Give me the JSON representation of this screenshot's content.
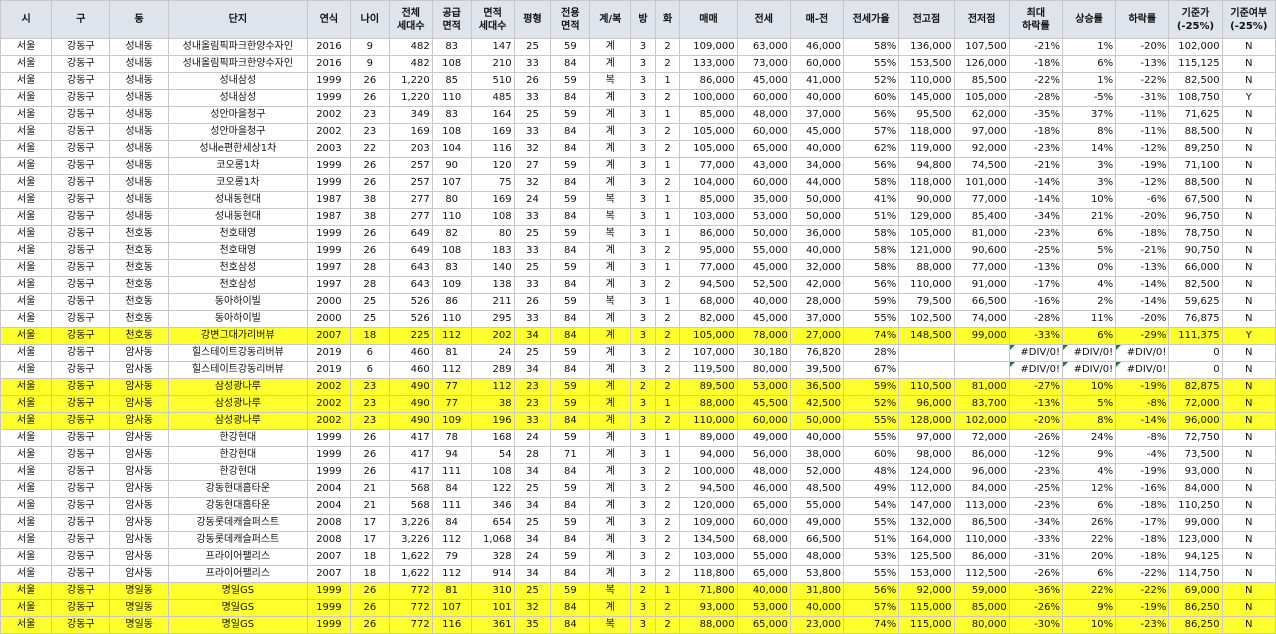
{
  "headers": [
    "시",
    "구",
    "동",
    "단지",
    "연식",
    "나이",
    "전체\n세대수",
    "공급\n면적",
    "면적\n세대수",
    "평형",
    "전용\n면적",
    "계/복",
    "방",
    "화",
    "매매",
    "전세",
    "매-전",
    "전세가율",
    "전고점",
    "전저점",
    "최대\n하락률",
    "상승률",
    "하락률",
    "기준가\n(-25%)",
    "기준여부\n(-25%)"
  ],
  "rows": [
    {
      "hl": false,
      "cells": [
        "서울",
        "강동구",
        "성내동",
        "성내올림픽파크한양수자인",
        "2016",
        "9",
        "482",
        "83",
        "147",
        "25",
        "59",
        "계",
        "3",
        "2",
        "109,000",
        "63,000",
        "46,000",
        "58%",
        "136,000",
        "107,500",
        "-21%",
        "1%",
        "-20%",
        "102,000",
        "N"
      ]
    },
    {
      "hl": false,
      "cells": [
        "서울",
        "강동구",
        "성내동",
        "성내올림픽파크한양수자인",
        "2016",
        "9",
        "482",
        "108",
        "210",
        "33",
        "84",
        "계",
        "3",
        "2",
        "133,000",
        "73,000",
        "60,000",
        "55%",
        "153,500",
        "126,000",
        "-18%",
        "6%",
        "-13%",
        "115,125",
        "N"
      ]
    },
    {
      "hl": false,
      "cells": [
        "서울",
        "강동구",
        "성내동",
        "성내삼성",
        "1999",
        "26",
        "1,220",
        "85",
        "510",
        "26",
        "59",
        "복",
        "3",
        "1",
        "86,000",
        "45,000",
        "41,000",
        "52%",
        "110,000",
        "85,500",
        "-22%",
        "1%",
        "-22%",
        "82,500",
        "N"
      ]
    },
    {
      "hl": false,
      "cells": [
        "서울",
        "강동구",
        "성내동",
        "성내삼성",
        "1999",
        "26",
        "1,220",
        "110",
        "485",
        "33",
        "84",
        "계",
        "3",
        "2",
        "100,000",
        "60,000",
        "40,000",
        "60%",
        "145,000",
        "105,000",
        "-28%",
        "-5%",
        "-31%",
        "108,750",
        "Y"
      ]
    },
    {
      "hl": false,
      "cells": [
        "서울",
        "강동구",
        "성내동",
        "성안마을청구",
        "2002",
        "23",
        "349",
        "83",
        "164",
        "25",
        "59",
        "계",
        "3",
        "1",
        "85,000",
        "48,000",
        "37,000",
        "56%",
        "95,500",
        "62,000",
        "-35%",
        "37%",
        "-11%",
        "71,625",
        "N"
      ]
    },
    {
      "hl": false,
      "cells": [
        "서울",
        "강동구",
        "성내동",
        "성안마을청구",
        "2002",
        "23",
        "169",
        "108",
        "169",
        "33",
        "84",
        "계",
        "3",
        "2",
        "105,000",
        "60,000",
        "45,000",
        "57%",
        "118,000",
        "97,000",
        "-18%",
        "8%",
        "-11%",
        "88,500",
        "N"
      ]
    },
    {
      "hl": false,
      "cells": [
        "서울",
        "강동구",
        "성내동",
        "성내e편한세상1차",
        "2003",
        "22",
        "203",
        "104",
        "116",
        "32",
        "84",
        "계",
        "3",
        "2",
        "105,000",
        "65,000",
        "40,000",
        "62%",
        "119,000",
        "92,000",
        "-23%",
        "14%",
        "-12%",
        "89,250",
        "N"
      ]
    },
    {
      "hl": false,
      "cells": [
        "서울",
        "강동구",
        "성내동",
        "코오롱1차",
        "1999",
        "26",
        "257",
        "90",
        "120",
        "27",
        "59",
        "계",
        "3",
        "1",
        "77,000",
        "43,000",
        "34,000",
        "56%",
        "94,800",
        "74,500",
        "-21%",
        "3%",
        "-19%",
        "71,100",
        "N"
      ]
    },
    {
      "hl": false,
      "cells": [
        "서울",
        "강동구",
        "성내동",
        "코오롱1차",
        "1999",
        "26",
        "257",
        "107",
        "75",
        "32",
        "84",
        "계",
        "3",
        "2",
        "104,000",
        "60,000",
        "44,000",
        "58%",
        "118,000",
        "101,000",
        "-14%",
        "3%",
        "-12%",
        "88,500",
        "N"
      ]
    },
    {
      "hl": false,
      "cells": [
        "서울",
        "강동구",
        "성내동",
        "성내동현대",
        "1987",
        "38",
        "277",
        "80",
        "169",
        "24",
        "59",
        "복",
        "3",
        "1",
        "85,000",
        "35,000",
        "50,000",
        "41%",
        "90,000",
        "77,000",
        "-14%",
        "10%",
        "-6%",
        "67,500",
        "N"
      ]
    },
    {
      "hl": false,
      "cells": [
        "서울",
        "강동구",
        "성내동",
        "성내동현대",
        "1987",
        "38",
        "277",
        "110",
        "108",
        "33",
        "84",
        "복",
        "3",
        "1",
        "103,000",
        "53,000",
        "50,000",
        "51%",
        "129,000",
        "85,400",
        "-34%",
        "21%",
        "-20%",
        "96,750",
        "N"
      ]
    },
    {
      "hl": false,
      "cells": [
        "서울",
        "강동구",
        "천호동",
        "천호태영",
        "1999",
        "26",
        "649",
        "82",
        "80",
        "25",
        "59",
        "복",
        "3",
        "1",
        "86,000",
        "50,000",
        "36,000",
        "58%",
        "105,000",
        "81,000",
        "-23%",
        "6%",
        "-18%",
        "78,750",
        "N"
      ]
    },
    {
      "hl": false,
      "cells": [
        "서울",
        "강동구",
        "천호동",
        "천호태영",
        "1999",
        "26",
        "649",
        "108",
        "183",
        "33",
        "84",
        "계",
        "3",
        "2",
        "95,000",
        "55,000",
        "40,000",
        "58%",
        "121,000",
        "90,600",
        "-25%",
        "5%",
        "-21%",
        "90,750",
        "N"
      ]
    },
    {
      "hl": false,
      "cells": [
        "서울",
        "강동구",
        "천호동",
        "천호삼성",
        "1997",
        "28",
        "643",
        "83",
        "140",
        "25",
        "59",
        "계",
        "3",
        "1",
        "77,000",
        "45,000",
        "32,000",
        "58%",
        "88,000",
        "77,000",
        "-13%",
        "0%",
        "-13%",
        "66,000",
        "N"
      ]
    },
    {
      "hl": false,
      "cells": [
        "서울",
        "강동구",
        "천호동",
        "천호삼성",
        "1997",
        "28",
        "643",
        "109",
        "138",
        "33",
        "84",
        "계",
        "3",
        "2",
        "94,500",
        "52,500",
        "42,000",
        "56%",
        "110,000",
        "91,000",
        "-17%",
        "4%",
        "-14%",
        "82,500",
        "N"
      ]
    },
    {
      "hl": false,
      "cells": [
        "서울",
        "강동구",
        "천호동",
        "동아하이빌",
        "2000",
        "25",
        "526",
        "86",
        "211",
        "26",
        "59",
        "복",
        "3",
        "1",
        "68,000",
        "40,000",
        "28,000",
        "59%",
        "79,500",
        "66,500",
        "-16%",
        "2%",
        "-14%",
        "59,625",
        "N"
      ]
    },
    {
      "hl": false,
      "cells": [
        "서울",
        "강동구",
        "천호동",
        "동아하이빌",
        "2000",
        "25",
        "526",
        "110",
        "295",
        "33",
        "84",
        "계",
        "3",
        "2",
        "82,000",
        "45,000",
        "37,000",
        "55%",
        "102,500",
        "74,000",
        "-28%",
        "11%",
        "-20%",
        "76,875",
        "N"
      ]
    },
    {
      "hl": true,
      "cells": [
        "서울",
        "강동구",
        "천호동",
        "강변그대가리버뷰",
        "2007",
        "18",
        "225",
        "112",
        "202",
        "34",
        "84",
        "계",
        "3",
        "2",
        "105,000",
        "78,000",
        "27,000",
        "74%",
        "148,500",
        "99,000",
        "-33%",
        "6%",
        "-29%",
        "111,375",
        "Y"
      ]
    },
    {
      "hl": false,
      "cells": [
        "서울",
        "강동구",
        "암사동",
        "힐스테이트강동리버뷰",
        "2019",
        "6",
        "460",
        "81",
        "24",
        "25",
        "59",
        "계",
        "3",
        "2",
        "107,000",
        "30,180",
        "76,820",
        "28%",
        "",
        "",
        "#DIV/0!",
        "#DIV/0!",
        "#DIV/0!",
        "0",
        "N"
      ]
    },
    {
      "hl": false,
      "cells": [
        "서울",
        "강동구",
        "암사동",
        "힐스테이트강동리버뷰",
        "2019",
        "6",
        "460",
        "112",
        "289",
        "34",
        "84",
        "계",
        "3",
        "2",
        "119,500",
        "80,000",
        "39,500",
        "67%",
        "",
        "",
        "#DIV/0!",
        "#DIV/0!",
        "#DIV/0!",
        "0",
        "N"
      ]
    },
    {
      "hl": true,
      "cells": [
        "서울",
        "강동구",
        "암사동",
        "삼성광나루",
        "2002",
        "23",
        "490",
        "77",
        "112",
        "23",
        "59",
        "계",
        "2",
        "2",
        "89,500",
        "53,000",
        "36,500",
        "59%",
        "110,500",
        "81,000",
        "-27%",
        "10%",
        "-19%",
        "82,875",
        "N"
      ]
    },
    {
      "hl": true,
      "cells": [
        "서울",
        "강동구",
        "암사동",
        "삼성광나루",
        "2002",
        "23",
        "490",
        "77",
        "38",
        "23",
        "59",
        "계",
        "3",
        "1",
        "88,000",
        "45,500",
        "42,500",
        "52%",
        "96,000",
        "83,700",
        "-13%",
        "5%",
        "-8%",
        "72,000",
        "N"
      ]
    },
    {
      "hl": true,
      "cells": [
        "서울",
        "강동구",
        "암사동",
        "삼성광나루",
        "2002",
        "23",
        "490",
        "109",
        "196",
        "33",
        "84",
        "계",
        "3",
        "2",
        "110,000",
        "60,000",
        "50,000",
        "55%",
        "128,000",
        "102,000",
        "-20%",
        "8%",
        "-14%",
        "96,000",
        "N"
      ]
    },
    {
      "hl": false,
      "cells": [
        "서울",
        "강동구",
        "암사동",
        "한강현대",
        "1999",
        "26",
        "417",
        "78",
        "168",
        "24",
        "59",
        "계",
        "3",
        "1",
        "89,000",
        "49,000",
        "40,000",
        "55%",
        "97,000",
        "72,000",
        "-26%",
        "24%",
        "-8%",
        "72,750",
        "N"
      ]
    },
    {
      "hl": false,
      "cells": [
        "서울",
        "강동구",
        "암사동",
        "한강현대",
        "1999",
        "26",
        "417",
        "94",
        "54",
        "28",
        "71",
        "계",
        "3",
        "1",
        "94,000",
        "56,000",
        "38,000",
        "60%",
        "98,000",
        "86,000",
        "-12%",
        "9%",
        "-4%",
        "73,500",
        "N"
      ]
    },
    {
      "hl": false,
      "cells": [
        "서울",
        "강동구",
        "암사동",
        "한강현대",
        "1999",
        "26",
        "417",
        "111",
        "108",
        "34",
        "84",
        "계",
        "3",
        "2",
        "100,000",
        "48,000",
        "52,000",
        "48%",
        "124,000",
        "96,000",
        "-23%",
        "4%",
        "-19%",
        "93,000",
        "N"
      ]
    },
    {
      "hl": false,
      "cells": [
        "서울",
        "강동구",
        "암사동",
        "강동현대홈타운",
        "2004",
        "21",
        "568",
        "84",
        "122",
        "25",
        "59",
        "계",
        "3",
        "2",
        "94,500",
        "46,000",
        "48,500",
        "49%",
        "112,000",
        "84,000",
        "-25%",
        "12%",
        "-16%",
        "84,000",
        "N"
      ]
    },
    {
      "hl": false,
      "cells": [
        "서울",
        "강동구",
        "암사동",
        "강동현대홈타운",
        "2004",
        "21",
        "568",
        "111",
        "346",
        "34",
        "84",
        "계",
        "3",
        "2",
        "120,000",
        "65,000",
        "55,000",
        "54%",
        "147,000",
        "113,000",
        "-23%",
        "6%",
        "-18%",
        "110,250",
        "N"
      ]
    },
    {
      "hl": false,
      "cells": [
        "서울",
        "강동구",
        "암사동",
        "강동롯데캐슬퍼스트",
        "2008",
        "17",
        "3,226",
        "84",
        "654",
        "25",
        "59",
        "계",
        "3",
        "2",
        "109,000",
        "60,000",
        "49,000",
        "55%",
        "132,000",
        "86,500",
        "-34%",
        "26%",
        "-17%",
        "99,000",
        "N"
      ]
    },
    {
      "hl": false,
      "cells": [
        "서울",
        "강동구",
        "암사동",
        "강동롯데캐슬퍼스트",
        "2008",
        "17",
        "3,226",
        "112",
        "1,068",
        "34",
        "84",
        "계",
        "3",
        "2",
        "134,500",
        "68,000",
        "66,500",
        "51%",
        "164,000",
        "110,000",
        "-33%",
        "22%",
        "-18%",
        "123,000",
        "N"
      ]
    },
    {
      "hl": false,
      "cells": [
        "서울",
        "강동구",
        "암사동",
        "프라이어팰리스",
        "2007",
        "18",
        "1,622",
        "79",
        "328",
        "24",
        "59",
        "계",
        "3",
        "2",
        "103,000",
        "55,000",
        "48,000",
        "53%",
        "125,500",
        "86,000",
        "-31%",
        "20%",
        "-18%",
        "94,125",
        "N"
      ]
    },
    {
      "hl": false,
      "cells": [
        "서울",
        "강동구",
        "암사동",
        "프라이어팰리스",
        "2007",
        "18",
        "1,622",
        "112",
        "914",
        "34",
        "84",
        "계",
        "3",
        "2",
        "118,800",
        "65,000",
        "53,800",
        "55%",
        "153,000",
        "112,500",
        "-26%",
        "6%",
        "-22%",
        "114,750",
        "N"
      ]
    },
    {
      "hl": true,
      "cells": [
        "서울",
        "강동구",
        "명일동",
        "명일GS",
        "1999",
        "26",
        "772",
        "81",
        "310",
        "25",
        "59",
        "복",
        "2",
        "1",
        "71,800",
        "40,000",
        "31,800",
        "56%",
        "92,000",
        "59,000",
        "-36%",
        "22%",
        "-22%",
        "69,000",
        "N"
      ]
    },
    {
      "hl": true,
      "cells": [
        "서울",
        "강동구",
        "명일동",
        "명일GS",
        "1999",
        "26",
        "772",
        "107",
        "101",
        "32",
        "84",
        "계",
        "3",
        "2",
        "93,000",
        "53,000",
        "40,000",
        "57%",
        "115,000",
        "85,000",
        "-26%",
        "9%",
        "-19%",
        "86,250",
        "N"
      ]
    },
    {
      "hl": true,
      "cells": [
        "서울",
        "강동구",
        "명일동",
        "명일GS",
        "1999",
        "26",
        "772",
        "116",
        "361",
        "35",
        "84",
        "복",
        "3",
        "2",
        "88,000",
        "65,000",
        "23,000",
        "74%",
        "115,000",
        "80,000",
        "-30%",
        "10%",
        "-23%",
        "86,250",
        "N"
      ]
    }
  ]
}
